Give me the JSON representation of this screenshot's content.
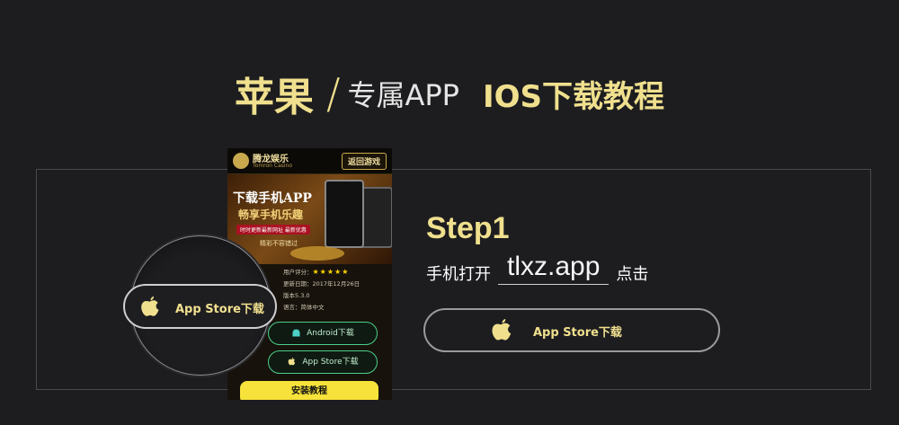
{
  "heading": {
    "brand": "苹果",
    "slash": "/",
    "subtitle": "专属APP",
    "tutorial": "IOS下载教程"
  },
  "phone": {
    "brand": "腾龙娱乐",
    "brand_en": "Tomron Casino",
    "back_button": "返回游戏",
    "banner_line1": "下载手机APP",
    "banner_line2": "畅享手机乐趣",
    "banner_tag": "时时更新最新网址 最新优惠",
    "banner_caption": "精彩不容错过",
    "rating_label": "用户评分：",
    "rating_stars": "★★★★★",
    "update_date": "更新日期：2017年12月26日",
    "version": "版本5.3.0",
    "language": "语言：简体中文",
    "android_button": "Android下载",
    "ios_button": "App Store下载",
    "install_button": "安装教程"
  },
  "zoom": {
    "label": "App Store下载"
  },
  "step": {
    "title": "Step1",
    "prefix": "手机打开",
    "url": "tlxz.app",
    "suffix": "点击",
    "button_label": "App Store下载"
  },
  "colors": {
    "accent": "#f0e08e",
    "background": "#1d1d20",
    "android_green": "#4bd08a",
    "install_yellow": "#f6e23a"
  },
  "icons": {
    "apple": "apple-icon",
    "android": "android-icon",
    "logo": "casino-logo-icon"
  }
}
